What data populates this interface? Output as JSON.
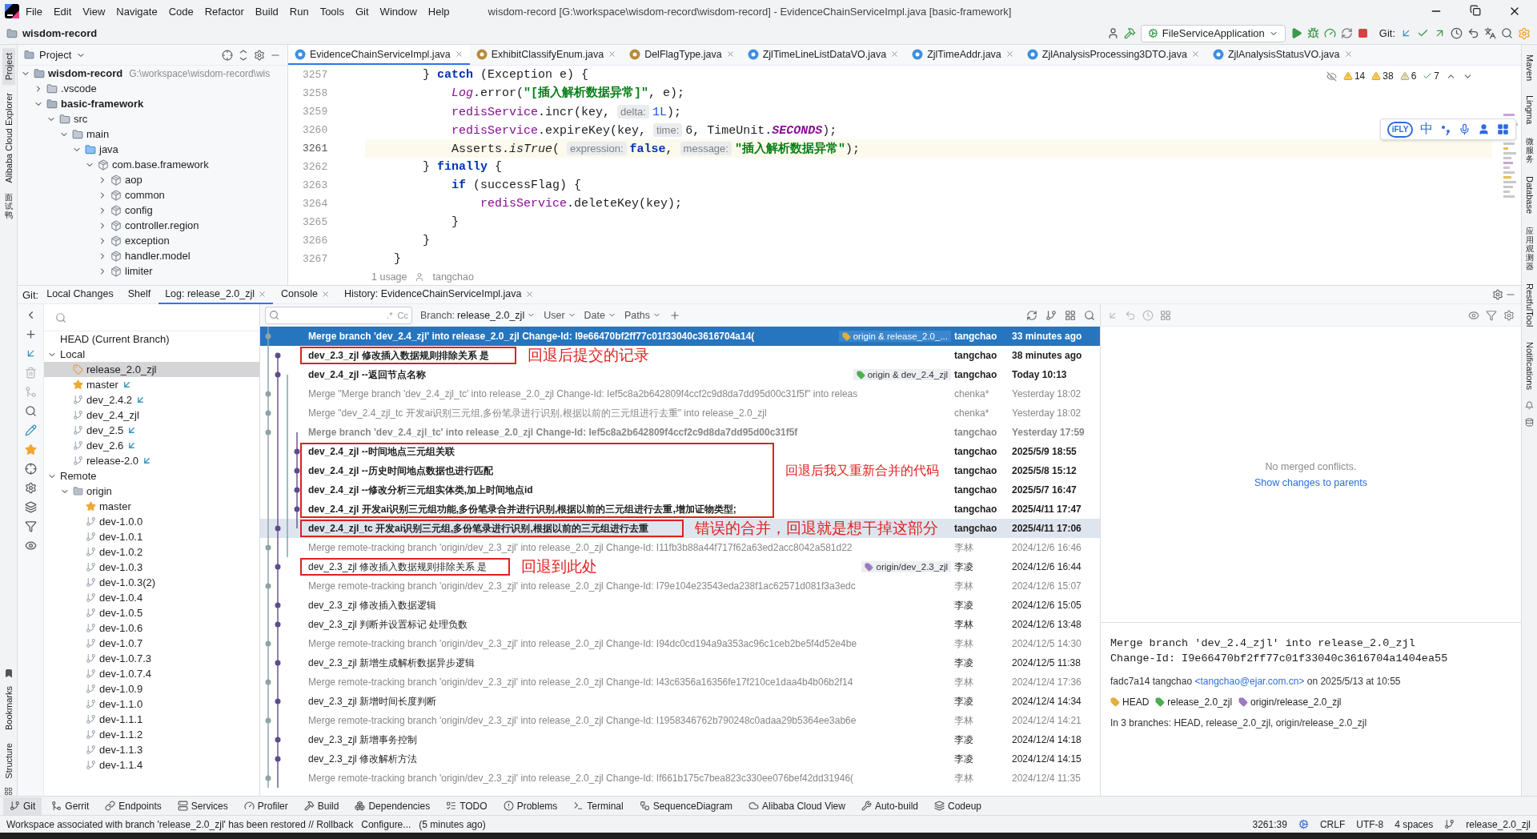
{
  "window": {
    "menu": [
      "File",
      "Edit",
      "View",
      "Navigate",
      "Code",
      "Refactor",
      "Build",
      "Run",
      "Tools",
      "Git",
      "Window",
      "Help"
    ],
    "title": "wisdom-record [G:\\workspace\\wisdom-record\\wisdom-record] - EvidenceChainServiceImpl.java [basic-framework]"
  },
  "toolbar": {
    "project": "wisdom-record",
    "run_config": "FileServiceApplication",
    "git_label": "Git:"
  },
  "left_stripe": [
    {
      "label": "Project",
      "selected": true
    },
    {
      "label": "Alibaba Cloud Explorer",
      "selected": false
    },
    {
      "label": "面试鸭",
      "selected": false
    }
  ],
  "left_stripe_bottom": [
    "Bookmarks",
    "Structure"
  ],
  "right_stripe": [
    "Maven",
    "Lingma",
    "微服务",
    "Database",
    "应用观测器",
    "RestfulTool",
    "Notifications"
  ],
  "project_panel": {
    "title": "Project",
    "tree": [
      {
        "name": "wisdom-record",
        "kind": "module",
        "path": "G:\\workspace\\wisdom-record\\wis",
        "expanded": true,
        "children": [
          {
            "name": ".vscode",
            "kind": "folder",
            "expanded": false
          },
          {
            "name": "basic-framework",
            "kind": "module",
            "expanded": true,
            "children": [
              {
                "name": "src",
                "kind": "folder",
                "expanded": true,
                "children": [
                  {
                    "name": "main",
                    "kind": "folder",
                    "expanded": true,
                    "children": [
                      {
                        "name": "java",
                        "kind": "source",
                        "expanded": true,
                        "children": [
                          {
                            "name": "com.base.framework",
                            "kind": "package",
                            "expanded": true,
                            "children": [
                              {
                                "name": "aop",
                                "kind": "package",
                                "expanded": false
                              },
                              {
                                "name": "common",
                                "kind": "package",
                                "expanded": false
                              },
                              {
                                "name": "config",
                                "kind": "package",
                                "expanded": false
                              },
                              {
                                "name": "controller.region",
                                "kind": "package",
                                "expanded": false
                              },
                              {
                                "name": "exception",
                                "kind": "package",
                                "expanded": false
                              },
                              {
                                "name": "handler.model",
                                "kind": "package",
                                "expanded": false
                              },
                              {
                                "name": "limiter",
                                "kind": "package",
                                "expanded": false
                              }
                            ]
                          }
                        ]
                      }
                    ]
                  }
                ]
              }
            ]
          }
        ]
      }
    ]
  },
  "editor": {
    "tabs": [
      {
        "label": "EvidenceChainServiceImpl.java",
        "kind": "class",
        "selected": true
      },
      {
        "label": "ExhibitClassifyEnum.java",
        "kind": "enum",
        "selected": false
      },
      {
        "label": "DelFlagType.java",
        "kind": "enum",
        "selected": false
      },
      {
        "label": "ZjlTimeLineListDataVO.java",
        "kind": "class",
        "selected": false
      },
      {
        "label": "ZjlTimeAddr.java",
        "kind": "class",
        "selected": false
      },
      {
        "label": "ZjlAnalysisProcessing3DTO.java",
        "kind": "class",
        "selected": false
      },
      {
        "label": "ZjlAnalysisStatusVO.java",
        "kind": "class",
        "selected": false
      }
    ],
    "inspections": [
      {
        "count": "14",
        "kind": "warning"
      },
      {
        "count": "38",
        "kind": "warning"
      },
      {
        "count": "6",
        "kind": "weak"
      },
      {
        "count": "7",
        "kind": "typo"
      }
    ],
    "lines": [
      {
        "number": "3257",
        "current": false,
        "segments": [
          {
            "kind": "plain",
            "text": "        } "
          },
          {
            "kind": "keyword",
            "text": "catch"
          },
          {
            "kind": "plain",
            "text": " (Exception e) {"
          }
        ]
      },
      {
        "number": "3258",
        "current": false,
        "segments": [
          {
            "kind": "static",
            "text": "            Log"
          },
          {
            "kind": "plain",
            "text": ".error("
          },
          {
            "kind": "string",
            "text": "\"[插入解析数据异常]\""
          },
          {
            "kind": "plain",
            "text": ", e);"
          }
        ]
      },
      {
        "number": "3259",
        "current": false,
        "segments": [
          {
            "kind": "field",
            "text": "            redisService"
          },
          {
            "kind": "plain",
            "text": ".incr(key, "
          },
          {
            "kind": "hint",
            "text": "delta:"
          },
          {
            "kind": "number",
            "text": "1L"
          },
          {
            "kind": "plain",
            "text": ");"
          }
        ]
      },
      {
        "number": "3260",
        "current": false,
        "segments": [
          {
            "kind": "field",
            "text": "            redisService"
          },
          {
            "kind": "plain",
            "text": ".expireKey(key, "
          },
          {
            "kind": "hint",
            "text": "time:"
          },
          {
            "kind": "plain",
            "text": "6, TimeUnit."
          },
          {
            "kind": "constant",
            "text": "SECONDS"
          },
          {
            "kind": "plain",
            "text": ");"
          }
        ]
      },
      {
        "number": "3261",
        "current": true,
        "segments": [
          {
            "kind": "plain",
            "text": "            Asserts."
          },
          {
            "kind": "method",
            "text": "isTrue"
          },
          {
            "kind": "plain",
            "text": "( "
          },
          {
            "kind": "hint",
            "text": "expression:"
          },
          {
            "kind": "keyword",
            "text": "false"
          },
          {
            "kind": "plain",
            "text": ", "
          },
          {
            "kind": "hint",
            "text": "message:"
          },
          {
            "kind": "string",
            "text": "\"插入解析数据异常\""
          },
          {
            "kind": "plain",
            "text": ");"
          }
        ]
      },
      {
        "number": "3262",
        "current": false,
        "segments": [
          {
            "kind": "plain",
            "text": "        } "
          },
          {
            "kind": "keyword",
            "text": "finally"
          },
          {
            "kind": "plain",
            "text": " {"
          }
        ]
      },
      {
        "number": "3263",
        "current": false,
        "segments": [
          {
            "kind": "keyword",
            "text": "            if"
          },
          {
            "kind": "plain",
            "text": " (successFlag) {"
          }
        ]
      },
      {
        "number": "3264",
        "current": false,
        "segments": [
          {
            "kind": "field",
            "text": "                redisService"
          },
          {
            "kind": "plain",
            "text": ".deleteKey(key);"
          }
        ]
      },
      {
        "number": "3265",
        "current": false,
        "segments": [
          {
            "kind": "plain",
            "text": "            }"
          }
        ]
      },
      {
        "number": "3266",
        "current": false,
        "segments": [
          {
            "kind": "plain",
            "text": "        }"
          }
        ]
      },
      {
        "number": "3267",
        "current": false,
        "segments": [
          {
            "kind": "plain",
            "text": "    }"
          }
        ]
      }
    ],
    "usage": {
      "label": "1 usage",
      "author": "tangchao"
    },
    "ime": {
      "badge": "iFLY",
      "mode": "中"
    }
  },
  "git": {
    "label": "Git:",
    "tabs": [
      {
        "label": "Local Changes",
        "selected": false,
        "closable": false
      },
      {
        "label": "Shelf",
        "selected": false,
        "closable": false
      },
      {
        "label": "Log: release_2.0_zjl",
        "selected": true,
        "closable": true
      },
      {
        "label": "Console",
        "selected": false,
        "closable": true
      },
      {
        "label": "History: EvidenceChainServiceImpl.java",
        "selected": false,
        "closable": true
      }
    ],
    "branches": [
      {
        "name": "HEAD (Current Branch)",
        "kind": "head",
        "selected": false
      },
      {
        "name": "Local",
        "kind": "group",
        "expanded": true,
        "selected": false,
        "children": [
          {
            "name": "release_2.0_zjl",
            "kind": "current",
            "selected": true,
            "incoming": false
          },
          {
            "name": "master",
            "kind": "favorite",
            "selected": false,
            "incoming": true
          },
          {
            "name": "dev_2.4.2",
            "kind": "branch",
            "selected": false,
            "incoming": true
          },
          {
            "name": "dev_2.4_zjl",
            "kind": "branch",
            "selected": false,
            "incoming": false
          },
          {
            "name": "dev_2.5",
            "kind": "branch",
            "selected": false,
            "incoming": true
          },
          {
            "name": "dev_2.6",
            "kind": "branch",
            "selected": false,
            "incoming": true
          },
          {
            "name": "release-2.0",
            "kind": "branch",
            "selected": false,
            "incoming": true
          }
        ]
      },
      {
        "name": "Remote",
        "kind": "group",
        "expanded": true,
        "selected": false,
        "children": [
          {
            "name": "origin",
            "kind": "remote",
            "expanded": true,
            "selected": false,
            "children": [
              {
                "name": "master",
                "kind": "favorite",
                "selected": false,
                "incoming": false
              },
              {
                "name": "dev-1.0.0",
                "kind": "branch",
                "selected": false,
                "incoming": false
              },
              {
                "name": "dev-1.0.1",
                "kind": "branch",
                "selected": false,
                "incoming": false
              },
              {
                "name": "dev-1.0.2",
                "kind": "branch",
                "selected": false,
                "incoming": false
              },
              {
                "name": "dev-1.0.3",
                "kind": "branch",
                "selected": false,
                "incoming": false
              },
              {
                "name": "dev-1.0.3(2)",
                "kind": "branch",
                "selected": false,
                "incoming": false
              },
              {
                "name": "dev-1.0.4",
                "kind": "branch",
                "selected": false,
                "incoming": false
              },
              {
                "name": "dev-1.0.5",
                "kind": "branch",
                "selected": false,
                "incoming": false
              },
              {
                "name": "dev-1.0.6",
                "kind": "branch",
                "selected": false,
                "incoming": false
              },
              {
                "name": "dev-1.0.7",
                "kind": "branch",
                "selected": false,
                "incoming": false
              },
              {
                "name": "dev-1.0.7.3",
                "kind": "branch",
                "selected": false,
                "incoming": false
              },
              {
                "name": "dev-1.0.7.4",
                "kind": "branch",
                "selected": false,
                "incoming": false
              },
              {
                "name": "dev-1.0.9",
                "kind": "branch",
                "selected": false,
                "incoming": false
              },
              {
                "name": "dev-1.1.0",
                "kind": "branch",
                "selected": false,
                "incoming": false
              },
              {
                "name": "dev-1.1.1",
                "kind": "branch",
                "selected": false,
                "incoming": false
              },
              {
                "name": "dev-1.1.2",
                "kind": "branch",
                "selected": false,
                "incoming": false
              },
              {
                "name": "dev-1.1.3",
                "kind": "branch",
                "selected": false,
                "incoming": false
              },
              {
                "name": "dev-1.1.4",
                "kind": "branch",
                "selected": false,
                "incoming": false
              }
            ]
          }
        ]
      }
    ],
    "filters": {
      "toggles": [
        ".*",
        "Cc"
      ],
      "branch_label": "Branch:",
      "branch": "release_2.0_zjl",
      "others": [
        "User",
        "Date",
        "Paths"
      ]
    },
    "log": [
      {
        "message": "Merge branch 'dev_2.4_zjl' into release_2.0_zjl Change-Id: I9e66470bf2ff77c01f33040c3616704a14(",
        "kind": "merge",
        "bold": true,
        "selected": true,
        "highlighted": false,
        "boxed": false,
        "tag": {
          "label": "origin & release_2.0_...",
          "color": "#e0b040"
        },
        "author": "tangchao",
        "date": "33 minutes ago"
      },
      {
        "message": "dev_2.3_zjl 修改插入数据规则排除关系 是",
        "kind": "commit",
        "bold": true,
        "selected": false,
        "highlighted": false,
        "boxed": true,
        "note": "回退后提交的记录",
        "author": "tangchao",
        "date": "38 minutes ago"
      },
      {
        "message": "dev_2.4_zjl --返回节点名称",
        "kind": "commit",
        "bold": true,
        "selected": false,
        "highlighted": false,
        "boxed": false,
        "tag": {
          "label": "origin & dev_2.4_zjl",
          "color": "#4caf50"
        },
        "author": "tangchao",
        "date": "Today 10:13"
      },
      {
        "message": "Merge \"Merge branch 'dev_2.4_zjl_tc' into release_2.0_zjl Change-Id: Ief5c8a2b642809f4ccf2c9d8da7dd95d00c31f5f\" into releas",
        "kind": "merge",
        "bold": false,
        "selected": false,
        "highlighted": false,
        "boxed": false,
        "author": "chenka*",
        "date": "Yesterday 18:02"
      },
      {
        "message": "Merge \"dev_2.4_zjl_tc 开发ai识别三元组,多份笔录进行识别,根据以前的三元组进行去重\" into release_2.0_zjl",
        "kind": "merge",
        "bold": false,
        "selected": false,
        "highlighted": false,
        "boxed": false,
        "author": "chenka*",
        "date": "Yesterday 18:02"
      },
      {
        "message": "Merge branch 'dev_2.4_zjl_tc' into release_2.0_zjl Change-Id: Ief5c8a2b642809f4ccf2c9d8da7dd95d00c31f5f",
        "kind": "merge",
        "bold": true,
        "selected": false,
        "highlighted": false,
        "boxed": false,
        "author": "tangchao",
        "date": "Yesterday 17:59"
      },
      {
        "message": "dev_2.4_zjl --时间地点三元组关联",
        "kind": "commit",
        "bold": true,
        "selected": false,
        "highlighted": false,
        "boxed": true,
        "author": "tangchao",
        "date": "2025/5/9 18:55"
      },
      {
        "message": "dev_2.4_zjl --历史时间地点数据也进行匹配",
        "kind": "commit",
        "bold": true,
        "selected": false,
        "highlighted": false,
        "boxed": true,
        "note": "回退后我又重新合并的代码",
        "author": "tangchao",
        "date": "2025/5/8 15:12"
      },
      {
        "message": "dev_2.4_zjl --修改分析三元组实体类,加上时间地点id",
        "kind": "commit",
        "bold": true,
        "selected": false,
        "highlighted": false,
        "boxed": true,
        "author": "tangchao",
        "date": "2025/5/7 16:47"
      },
      {
        "message": "dev_2.4_zjl 开发ai识别三元组功能,多份笔录合并进行识别,根据以前的三元组进行去重,增加证物类型;",
        "kind": "commit",
        "bold": true,
        "selected": false,
        "highlighted": false,
        "boxed": true,
        "author": "tangchao",
        "date": "2025/4/11 17:47"
      },
      {
        "message": "dev_2.4_zjl_tc 开发ai识别三元组,多份笔录进行识别,根据以前的三元组进行去重",
        "kind": "commit",
        "bold": true,
        "selected": false,
        "highlighted": true,
        "boxed": true,
        "box_start": true,
        "note": "错误的合并，回退就是想干掉这部分",
        "author": "tangchao",
        "date": "2025/4/11 17:06"
      },
      {
        "message": "Merge remote-tracking branch 'origin/dev_2.3_zjl' into release_2.0_zjl Change-Id: I11fb3b88a44f717f62a63ed2acc8042a581d22",
        "kind": "merge",
        "bold": false,
        "selected": false,
        "highlighted": false,
        "boxed": false,
        "author": "李林",
        "date": "2024/12/6 16:46"
      },
      {
        "message": "dev_2.3_zjl 修改插入数据规则排除关系 是",
        "kind": "commit",
        "bold": false,
        "selected": false,
        "highlighted": false,
        "boxed": true,
        "note": "回退到此处",
        "tag": {
          "label": "origin/dev_2.3_zjl",
          "color": "#9c7bc2"
        },
        "author": "李凌",
        "date": "2024/12/6 16:44"
      },
      {
        "message": "Merge remote-tracking branch 'origin/dev_2.3_zjl' into release_2.0_zjl Change-Id: I79e104e23543eda238f1ac62571d081f3a3edc",
        "kind": "merge",
        "bold": false,
        "selected": false,
        "highlighted": false,
        "boxed": false,
        "author": "李林",
        "date": "2024/12/6 15:07"
      },
      {
        "message": "dev_2.3_zjl 修改插入数据逻辑",
        "kind": "commit",
        "bold": false,
        "selected": false,
        "highlighted": false,
        "boxed": false,
        "author": "李凌",
        "date": "2024/12/6 15:05"
      },
      {
        "message": "dev_2.3_zjl 判断并设置标记 处理负数",
        "kind": "commit",
        "bold": false,
        "selected": false,
        "highlighted": false,
        "boxed": false,
        "author": "李林",
        "date": "2024/12/6 13:48"
      },
      {
        "message": "Merge remote-tracking branch 'origin/dev_2.3_zjl' into release_2.0_zjl Change-Id: I94dc0cd194a9a353ac96c1ceb2be5f4d52e4be",
        "kind": "merge",
        "bold": false,
        "selected": false,
        "highlighted": false,
        "boxed": false,
        "author": "李林",
        "date": "2024/12/5 14:30"
      },
      {
        "message": "dev_2.3_zjl 新增生成解析数据异步逻辑",
        "kind": "commit",
        "bold": false,
        "selected": false,
        "highlighted": false,
        "boxed": false,
        "author": "李凌",
        "date": "2024/12/5 11:38"
      },
      {
        "message": "Merge remote-tracking branch 'origin/dev_2.3_zjl' into release_2.0_zjl Change-Id: I43c6356a16356fe17f210ce1daa4b4b06b2f14",
        "kind": "merge",
        "bold": false,
        "selected": false,
        "highlighted": false,
        "boxed": false,
        "author": "李林",
        "date": "2024/12/4 17:36"
      },
      {
        "message": "dev_2.3_zjl 新增时间长度判断",
        "kind": "commit",
        "bold": false,
        "selected": false,
        "highlighted": false,
        "boxed": false,
        "author": "李凌",
        "date": "2024/12/4 14:34"
      },
      {
        "message": "Merge remote-tracking branch 'origin/dev_2.3_zjl' into release_2.0_zjl Change-Id: I1958346762b790248c0adaa29b5364ee3ab6e",
        "kind": "merge",
        "bold": false,
        "selected": false,
        "highlighted": false,
        "boxed": false,
        "author": "李林",
        "date": "2024/12/4 14:21"
      },
      {
        "message": "dev_2.3_zjl 新增事务控制",
        "kind": "commit",
        "bold": false,
        "selected": false,
        "highlighted": false,
        "boxed": false,
        "author": "李凌",
        "date": "2024/12/4 14:18"
      },
      {
        "message": "dev_2.3_zjl 修改解析方法",
        "kind": "commit",
        "bold": false,
        "selected": false,
        "highlighted": false,
        "boxed": false,
        "author": "李凌",
        "date": "2024/12/4 14:15"
      },
      {
        "message": "Merge remote-tracking branch 'origin/dev_2.3_zjl' into release_2.0_zjl Change-Id: If661b175c7bea823c330ee076bef42dd31946(",
        "kind": "merge",
        "bold": false,
        "selected": false,
        "highlighted": false,
        "boxed": false,
        "author": "李林",
        "date": "2024/12/4 11:35"
      }
    ],
    "details": {
      "conflicts": "No merged conflicts.",
      "link": "Show changes to parents",
      "message": [
        "Merge branch 'dev_2.4_zjl' into release_2.0_zjl",
        "Change-Id: I9e66470bf2ff77c01f33040c3616704a1404ea55"
      ],
      "hash": "fadc7a14",
      "author": "tangchao",
      "email": "<tangchao@ejar.com.cn>",
      "when": "on 2025/5/13 at 10:55",
      "refs": [
        {
          "label": "HEAD",
          "color": "#e0b040"
        },
        {
          "label": "release_2.0_zjl",
          "color": "#4caf50"
        },
        {
          "label": "origin/release_2.0_zjl",
          "color": "#9c7bc2"
        }
      ],
      "branches": "In 3 branches: HEAD, release_2.0_zjl, origin/release_2.0_zjl"
    }
  },
  "tool_windows": [
    {
      "label": "Git",
      "selected": true
    },
    {
      "label": "Gerrit",
      "selected": false
    },
    {
      "label": "Endpoints",
      "selected": false
    },
    {
      "label": "Services",
      "selected": false
    },
    {
      "label": "Profiler",
      "selected": false
    },
    {
      "label": "Build",
      "selected": false
    },
    {
      "label": "Dependencies",
      "selected": false
    },
    {
      "label": "TODO",
      "selected": false
    },
    {
      "label": "Problems",
      "selected": false
    },
    {
      "label": "Terminal",
      "selected": false
    },
    {
      "label": "SequenceDiagram",
      "selected": false
    },
    {
      "label": "Alibaba Cloud View",
      "selected": false
    },
    {
      "label": "Auto-build",
      "selected": false
    },
    {
      "label": "Codeup",
      "selected": false
    }
  ],
  "status_bar": {
    "message": "Workspace associated with branch 'release_2.0_zjl' has been restored // Rollback",
    "action": "Configure...",
    "age": "(5 minutes ago)",
    "position": "3261:39",
    "line_ending": "CRLF",
    "encoding": "UTF-8",
    "indent": "4 spaces",
    "branch": "release_2.0_zjl"
  }
}
